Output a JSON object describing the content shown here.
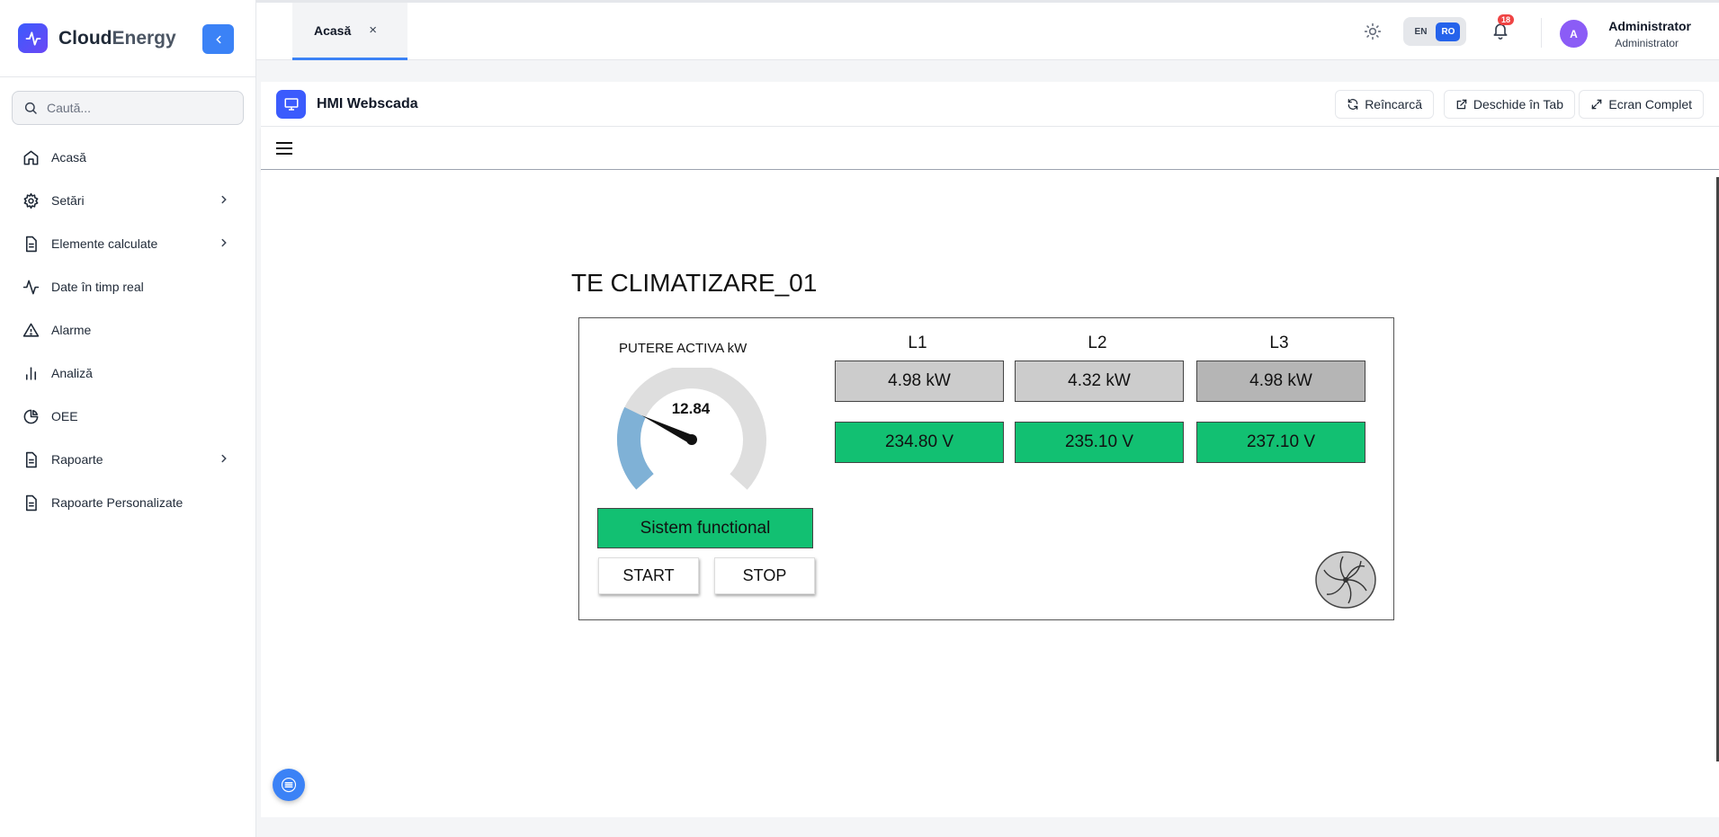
{
  "brand": {
    "name_part1": "Cloud",
    "name_part2": "Energy"
  },
  "search": {
    "placeholder": "Caută..."
  },
  "sidebar": {
    "items": [
      {
        "label": "Acasă",
        "icon": "home-icon"
      },
      {
        "label": "Setări",
        "icon": "gear-icon",
        "has_submenu": true
      },
      {
        "label": "Elemente calculate",
        "icon": "document-icon",
        "has_submenu": true
      },
      {
        "label": "Date în timp real",
        "icon": "activity-icon"
      },
      {
        "label": "Alarme",
        "icon": "warning-icon"
      },
      {
        "label": "Analiză",
        "icon": "bar-chart-icon"
      },
      {
        "label": "OEE",
        "icon": "pie-chart-icon"
      },
      {
        "label": "Rapoarte",
        "icon": "document-icon",
        "has_submenu": true
      },
      {
        "label": "Rapoarte Personalizate",
        "icon": "document-icon"
      }
    ]
  },
  "tabs": [
    {
      "label": "Acasă",
      "close": "×"
    }
  ],
  "header": {
    "lang_en": "EN",
    "lang_ro": "RO",
    "notifications_count": "18",
    "avatar_initial": "A",
    "user_name": "Administrator",
    "user_role": "Administrator"
  },
  "panel": {
    "title": "HMI Webscada",
    "buttons": {
      "reload": "Reîncarcă",
      "open_tab": "Deschide în Tab",
      "fullscreen": "Ecran Complet"
    }
  },
  "scada": {
    "title": "TE CLIMATIZARE_01",
    "gauge": {
      "label": "PUTERE ACTIVA kW",
      "value": "12.84",
      "value_num": 12.84,
      "max": 50
    },
    "phases": [
      {
        "label": "L1",
        "power": "4.98 kW",
        "voltage": "234.80 V"
      },
      {
        "label": "L2",
        "power": "4.32 kW",
        "voltage": "235.10 V"
      },
      {
        "label": "L3",
        "power": "4.98 kW",
        "voltage": "237.10 V"
      }
    ],
    "status": "Sistem functional",
    "start_label": "START",
    "stop_label": "STOP"
  },
  "colors": {
    "accent": "#3b82f6",
    "ok_green": "#12c072",
    "gauge_fill": "#7fb1d6",
    "badge_red": "#ef4444"
  }
}
